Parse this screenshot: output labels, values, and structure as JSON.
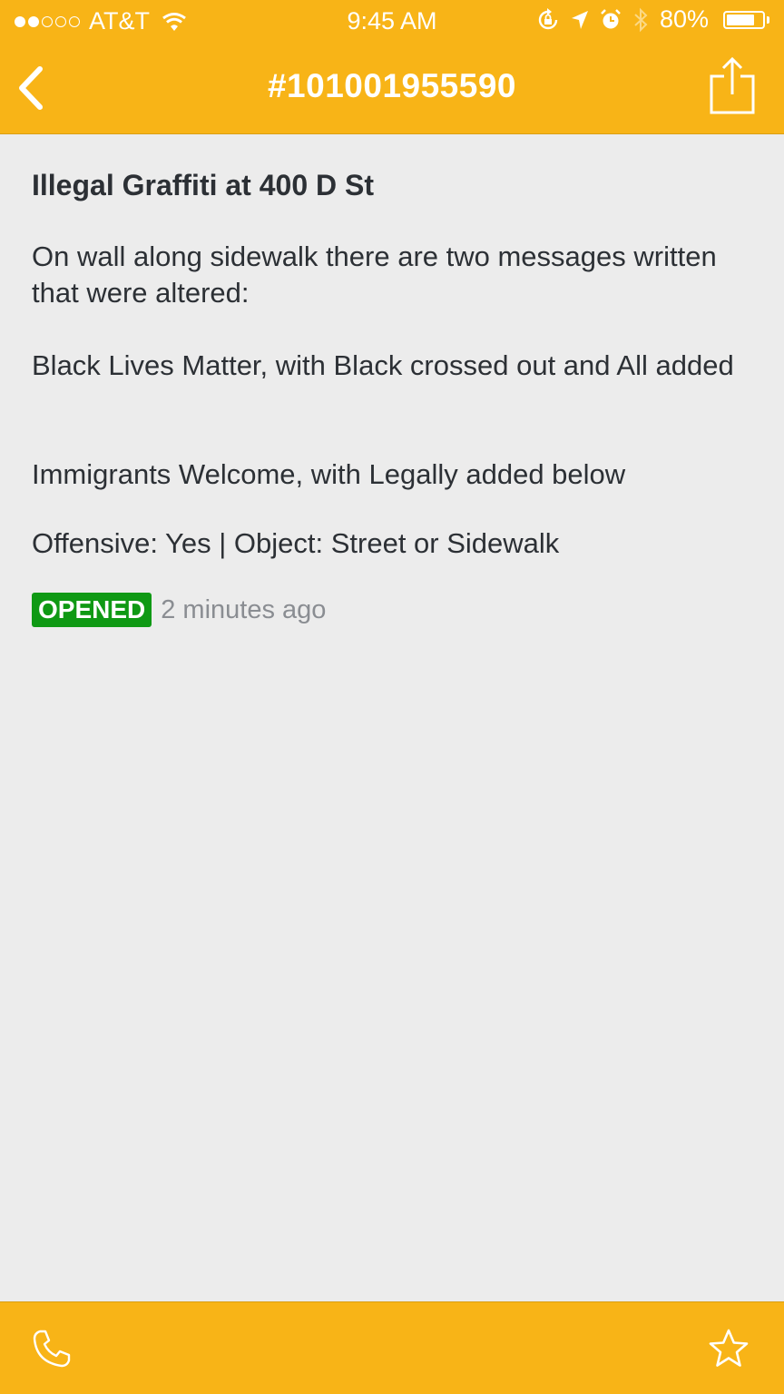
{
  "status_bar": {
    "carrier": "AT&T",
    "time": "9:45 AM",
    "battery": "80%",
    "battery_level": 0.8,
    "signal_bars_filled": 2,
    "signal_bars_total": 5
  },
  "nav": {
    "title": "#101001955590"
  },
  "report": {
    "title": "Illegal Graffiti at 400 D St",
    "paragraphs": [
      "On wall along sidewalk there are two messages written that were altered:",
      "Black Lives Matter, with Black crossed out and All added",
      "Immigrants Welcome, with Legally added below",
      "Offensive: Yes | Object: Street or Sidewalk"
    ],
    "status_badge": "OPENED",
    "time_ago": "2 minutes ago"
  },
  "icons": {
    "back": "chevron-left-icon",
    "share": "share-icon",
    "call": "phone-icon",
    "favorite": "star-icon"
  },
  "colors": {
    "accent": "#f8b417",
    "status_opened": "#0f9914",
    "background": "#ececec"
  }
}
